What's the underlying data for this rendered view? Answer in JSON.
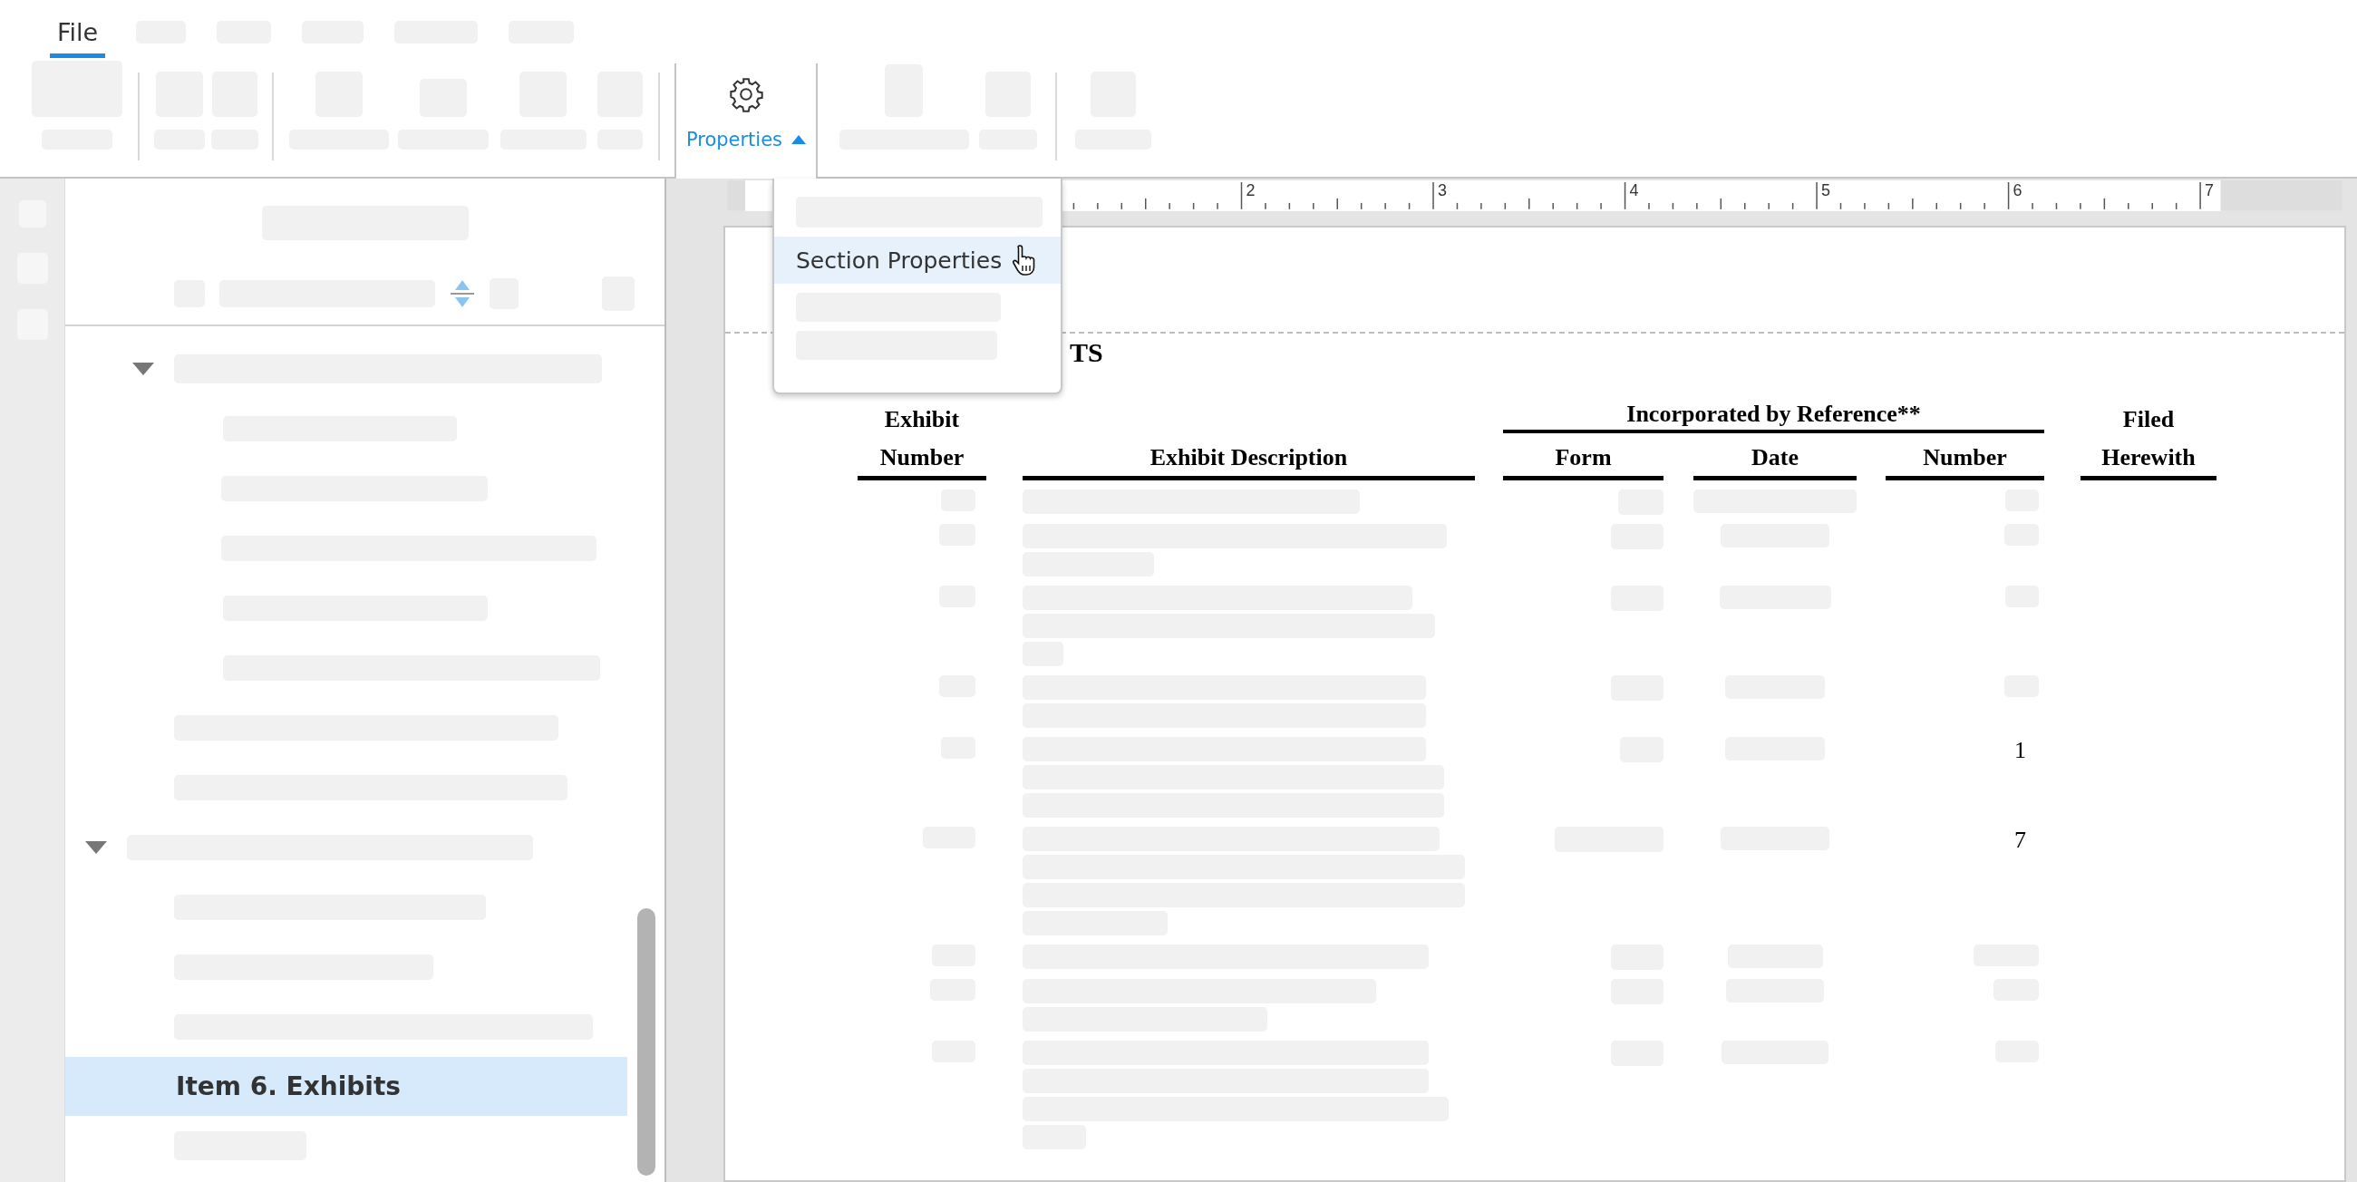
{
  "menu": [
    {
      "label": "File",
      "selected": true
    }
  ],
  "ribbon": {
    "properties_button": {
      "label": "Properties",
      "expanded": true
    }
  },
  "dropdown": {
    "items": [
      {
        "label": "Section Properties",
        "highlighted": true
      }
    ]
  },
  "outline": {
    "items": [
      {
        "label": "Item 6. Exhibits",
        "selected": true
      }
    ]
  },
  "ruler": {
    "labels": [
      "2",
      "3",
      "4",
      "5",
      "6",
      "7"
    ]
  },
  "document": {
    "heading": "TS",
    "table": {
      "group_header": "Incorporated by Reference**",
      "columns": [
        "Exhibit Number",
        "Exhibit Description",
        "Form",
        "Date",
        "Number",
        "Filed Herewith"
      ],
      "rows": [
        {
          "number": "1"
        },
        {
          "number": "7"
        }
      ]
    }
  }
}
